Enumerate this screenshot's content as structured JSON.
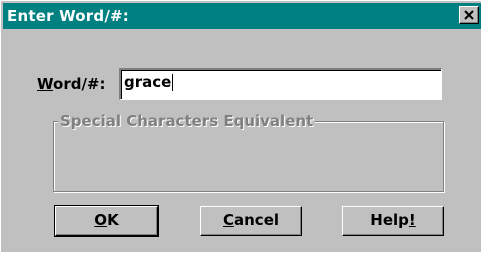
{
  "window": {
    "title": "Enter Word/#:"
  },
  "form": {
    "word_label_mnemonic": "W",
    "word_label_rest": "ord/#:",
    "word_value": "grace",
    "group_title": "Special Characters Equivalent"
  },
  "buttons": {
    "ok_mnemonic": "O",
    "ok_rest": "K",
    "cancel_mnemonic": "C",
    "cancel_rest": "ancel",
    "help_start": "Help",
    "help_mnemonic": "!"
  },
  "icons": {
    "close": "close-icon"
  },
  "colors": {
    "titlebar": "#008080",
    "face": "#c0c0c0",
    "disabled_text": "#808080"
  }
}
